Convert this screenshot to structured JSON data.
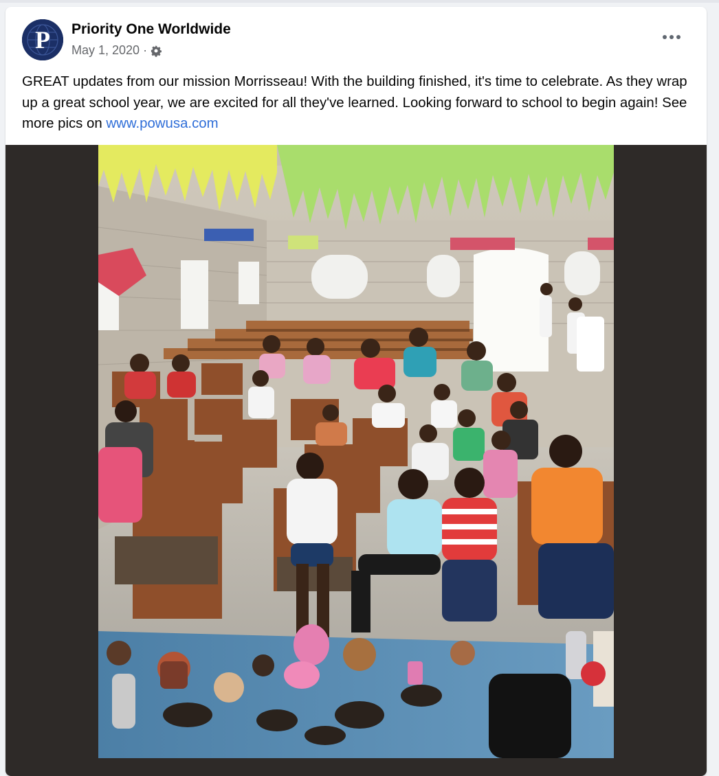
{
  "post": {
    "page_name": "Priority One Worldwide",
    "avatar_letter": "P",
    "date": "May 1, 2020",
    "separator": "·",
    "audience_icon": "gear-icon",
    "more_icon": "more-options-icon",
    "text_main": "GREAT updates from our mission Morrisseau!  With the building finished, it's time to celebrate. As they wrap up a great school year, we are excited for all they've learned. Looking forward to school to begin again!  See more pics on ",
    "link": "www.powusa.com"
  },
  "colors": {
    "brand_navy": "#1b2f66",
    "link": "#2f6ed8",
    "media_background": "#2e2a28"
  }
}
